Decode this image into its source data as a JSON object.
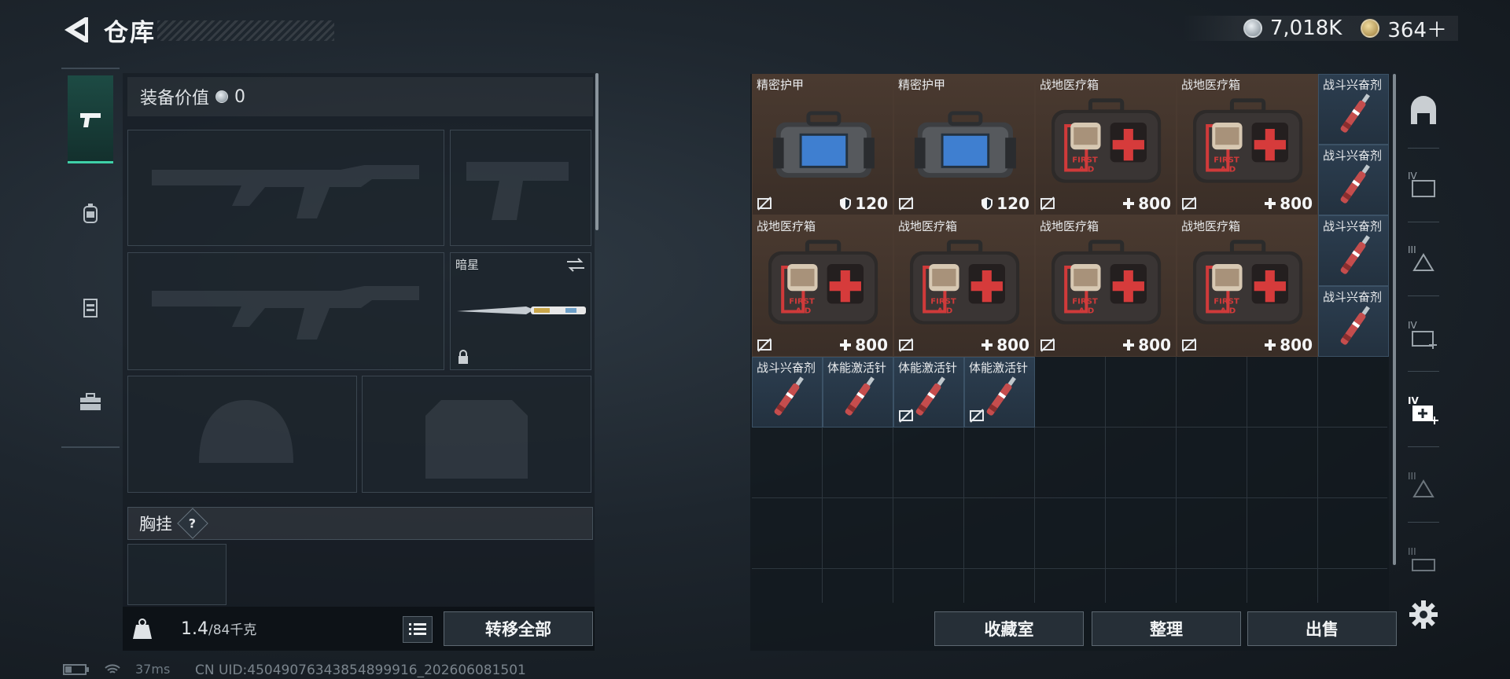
{
  "header": {
    "title": "仓库"
  },
  "currency": {
    "silver": "7,018K",
    "gold": "364＋"
  },
  "loadout": {
    "equipment_value_label": "装备价值",
    "equipment_value": "0",
    "melee_name": "暗星",
    "chest_rig_label": "胸挂",
    "help": "?"
  },
  "weight": {
    "current": "1.4",
    "max": "/84千克"
  },
  "buttons": {
    "transfer_all": "转移全部",
    "collection": "收藏室",
    "sort": "整理",
    "sell": "出售"
  },
  "storage": {
    "items": [
      {
        "name": "精密护甲",
        "value": "120",
        "kind": "armor"
      },
      {
        "name": "精密护甲",
        "value": "120",
        "kind": "armor"
      },
      {
        "name": "战地医疗箱",
        "value": "800",
        "kind": "medkit"
      },
      {
        "name": "战地医疗箱",
        "value": "800",
        "kind": "medkit"
      },
      {
        "name": "战斗兴奋剂",
        "kind": "stim"
      },
      {
        "name": "战斗兴奋剂",
        "kind": "stim"
      },
      {
        "name": "战地医疗箱",
        "value": "800",
        "kind": "medkit"
      },
      {
        "name": "战地医疗箱",
        "value": "800",
        "kind": "medkit"
      },
      {
        "name": "战地医疗箱",
        "value": "800",
        "kind": "medkit"
      },
      {
        "name": "战地医疗箱",
        "value": "800",
        "kind": "medkit"
      },
      {
        "name": "战斗兴奋剂",
        "kind": "stim"
      },
      {
        "name": "战斗兴奋剂",
        "kind": "stim"
      },
      {
        "name": "战斗兴奋剂",
        "kind": "stim"
      },
      {
        "name": "体能激活针",
        "kind": "stim"
      },
      {
        "name": "体能激活针",
        "kind": "stim"
      },
      {
        "name": "体能激活针",
        "kind": "stim"
      }
    ]
  },
  "side_icons": [
    "IV",
    "III",
    "IV",
    "IV",
    "III",
    "III"
  ],
  "status": {
    "ping": "37ms",
    "uid": "CN UID:450490763438548999​16_202606081501"
  },
  "colors": {
    "accent": "#3fd0a8",
    "item_brown": "#4a3a30",
    "item_blue": "#2c3e50"
  }
}
